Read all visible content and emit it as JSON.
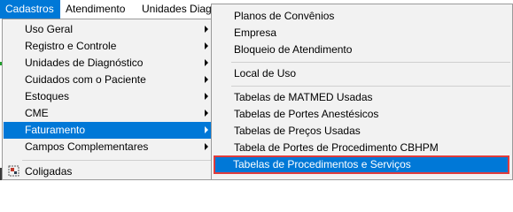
{
  "menubar": {
    "items": [
      {
        "label": "Cadastros"
      },
      {
        "label": "Atendimento"
      },
      {
        "label": "Unidades Diagn"
      }
    ]
  },
  "dropdown": {
    "items": [
      {
        "label": "Uso Geral"
      },
      {
        "label": "Registro e Controle"
      },
      {
        "label": "Unidades de Diagnóstico"
      },
      {
        "label": "Cuidados com o Paciente"
      },
      {
        "label": "Estoques"
      },
      {
        "label": "CME"
      },
      {
        "label": "Faturamento"
      },
      {
        "label": "Campos Complementares"
      },
      {
        "label": "Coligadas"
      }
    ]
  },
  "submenu": {
    "items": [
      {
        "label": "Planos de Convênios"
      },
      {
        "label": "Empresa"
      },
      {
        "label": "Bloqueio de Atendimento"
      },
      {
        "label": "Local de Uso"
      },
      {
        "label": "Tabelas de MATMED Usadas"
      },
      {
        "label": "Tabelas de Portes Anestésicos"
      },
      {
        "label": "Tabelas de Preços Usadas"
      },
      {
        "label": "Tabela de Portes de Procedimento CBHPM"
      },
      {
        "label": "Tabelas de Procedimentos e Serviços"
      }
    ]
  },
  "colors": {
    "selection": "#0078d7",
    "highlight_border": "#e03c3c",
    "menu_background": "#f2f2f2"
  }
}
